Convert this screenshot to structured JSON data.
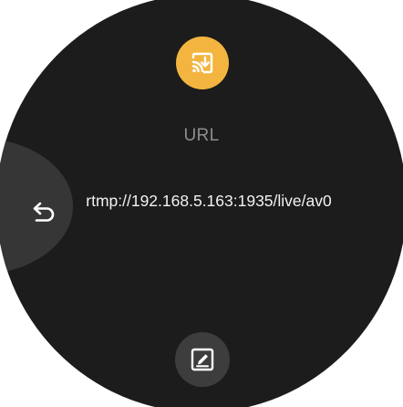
{
  "screen": {
    "title": "URL",
    "url_value": "rtmp://192.168.5.163:1935/live/av0"
  },
  "icons": {
    "cast": "cast-download-icon",
    "back": "back-arrow-icon",
    "edit": "edit-pencil-icon"
  },
  "colors": {
    "dial_background": "#1c1c1c",
    "accent": "#f3b53f",
    "label": "#8e8e8e",
    "text": "#f2f2f2",
    "button_background": "#3d3d3d"
  }
}
